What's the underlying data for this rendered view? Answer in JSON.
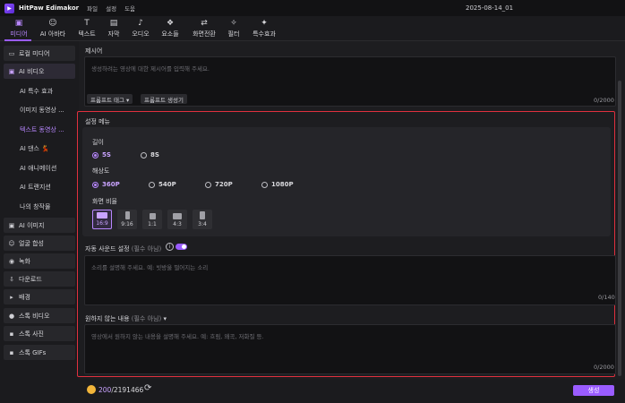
{
  "app": {
    "title": "HitPaw Edimakor",
    "logo_glyph": "▶",
    "menu": [
      "파일",
      "설정",
      "도움"
    ],
    "date": "2025-08-14_01"
  },
  "toolbar": [
    {
      "label": "미디어",
      "icon": "media-icon",
      "glyph": "▣",
      "active": true
    },
    {
      "label": "AI 아바타",
      "icon": "avatar-icon",
      "glyph": "☺"
    },
    {
      "label": "텍스트",
      "icon": "text-icon",
      "glyph": "T"
    },
    {
      "label": "자막",
      "icon": "subtitle-icon",
      "glyph": "▤"
    },
    {
      "label": "오디오",
      "icon": "audio-icon",
      "glyph": "♪"
    },
    {
      "label": "요소들",
      "icon": "elements-icon",
      "glyph": "❖"
    },
    {
      "label": "화면전환",
      "icon": "transition-icon",
      "glyph": "⇄"
    },
    {
      "label": "필터",
      "icon": "filter-icon",
      "glyph": "✧"
    },
    {
      "label": "특수효과",
      "icon": "effects-icon",
      "glyph": "✦"
    }
  ],
  "sidebar": {
    "local_media": "로컬 미디어",
    "ai_video": "AI 비디오",
    "sub_items": [
      "AI 특수 효과",
      "이미지 동영상 ...",
      "텍스트 동영상 ...",
      "AI 댄스 💃",
      "AI 애니메이션",
      "AI 트랜지션",
      "나의 창작물"
    ],
    "items": [
      "AI 이미지",
      "얼굴 합성",
      "녹화",
      "다운로드",
      "배경",
      "스톡 비디오",
      "스톡 사진",
      "스톡 GIFs"
    ]
  },
  "prompt": {
    "label": "제시어",
    "placeholder": "생성하려는 영상에 대한 제시어를 입력해 주세요.",
    "tag_button": "프롬프트 태그 ▾",
    "generator_button": "프롬프트 생성기",
    "counter": "0/2000"
  },
  "settings": {
    "label": "설정 메뉴",
    "length_label": "길이",
    "lengths": [
      "5S",
      "8S"
    ],
    "resolution_label": "해상도",
    "resolutions": [
      "360P",
      "540P",
      "720P",
      "1080P"
    ],
    "ratio_label": "화면 비율",
    "ratios": [
      "16:9",
      "9:16",
      "1:1",
      "4:3",
      "3:4"
    ]
  },
  "sound": {
    "label": "자동 사운드 설정",
    "optional": "(필수 아님)",
    "placeholder": "소리를 설명해 주세요. 예: 빗방울 떨어지는 소리",
    "counter": "0/140"
  },
  "negative": {
    "label": "원하지 않는 내용",
    "optional": "(필수 아님)",
    "placeholder": "영상에서 원하지 않는 내용을 설명해 주세요. 예: 흐림, 왜곡, 저화질 등.",
    "counter": "0/2000"
  },
  "credits": {
    "current": "200",
    "total": "/2191466"
  },
  "generate_button": "생성",
  "colors": {
    "accent": "#9a5cff",
    "highlight_border": "#e0303e"
  }
}
